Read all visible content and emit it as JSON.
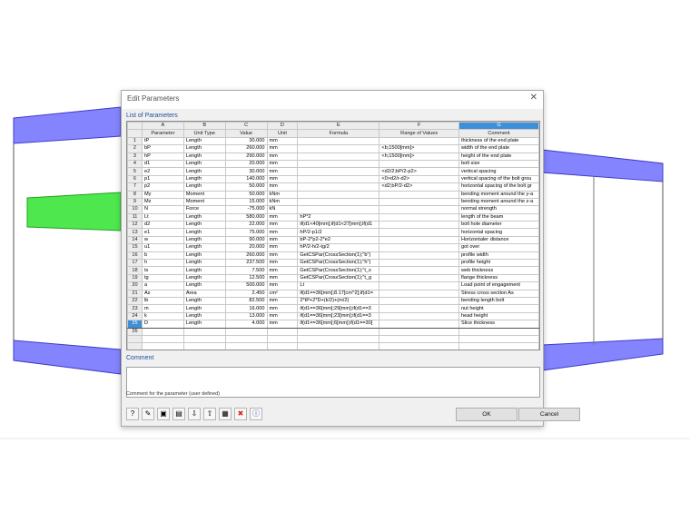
{
  "dialog": {
    "title": "Edit Parameters",
    "close_symbol": "✕",
    "list_label": "List of Parameters",
    "comment_label": "Comment",
    "comment_hint": "Comment for the parameter (user defined)",
    "ok_label": "OK",
    "cancel_label": "Cancel"
  },
  "table": {
    "letters": [
      "A",
      "B",
      "C",
      "D",
      "E",
      "F",
      "G"
    ],
    "headers": [
      "Parameter",
      "Unit Type",
      "Value",
      "Unit",
      "Formula",
      "Range of Values",
      "Comment"
    ],
    "rows": [
      {
        "num": "1",
        "cells": [
          "tP",
          "Length",
          "30.000",
          "mm",
          "",
          "",
          "thickness of the end plate"
        ]
      },
      {
        "num": "2",
        "cells": [
          "bP",
          "Length",
          "260.000",
          "mm",
          "",
          "<b;1500[mm]>",
          "width of the end plate"
        ]
      },
      {
        "num": "3",
        "cells": [
          "hP",
          "Length",
          "290.000",
          "mm",
          "",
          "<h;1500[mm]>",
          "height of the end plate"
        ]
      },
      {
        "num": "4",
        "cells": [
          "d1",
          "Length",
          "20.000",
          "mm",
          "",
          "",
          "bolt size"
        ]
      },
      {
        "num": "5",
        "cells": [
          "e2",
          "Length",
          "30.000",
          "mm",
          "",
          "<d2/2;bP/2-p2>",
          "vertical spacing"
        ]
      },
      {
        "num": "6",
        "cells": [
          "p1",
          "Length",
          "140.000",
          "mm",
          "",
          "<0>d2/r-d2>",
          "vertical spacing of the bolt grou"
        ]
      },
      {
        "num": "7",
        "cells": [
          "p2",
          "Length",
          "50.000",
          "mm",
          "",
          "<d2;bP/2-d2>",
          "horizontal spacing of the bolt gr"
        ]
      },
      {
        "num": "8",
        "cells": [
          "My",
          "Moment",
          "50.000",
          "kNm",
          "",
          "",
          "bending moment around the y-a"
        ]
      },
      {
        "num": "9",
        "cells": [
          "Mz",
          "Moment",
          "15.000",
          "kNm",
          "",
          "",
          "bending moment around the z-a"
        ]
      },
      {
        "num": "10",
        "cells": [
          "N",
          "Force",
          "-75.000",
          "kN",
          "",
          "",
          "normal strength"
        ]
      },
      {
        "num": "11",
        "cells": [
          "Lt",
          "Length",
          "580.000",
          "mm",
          "hP*2",
          "",
          "length of the beam"
        ]
      },
      {
        "num": "12",
        "cells": [
          "d2",
          "Length",
          "22.000",
          "mm",
          "if(d1<40[mm];if(d1<27[mm];if(d1",
          "",
          "bolt hole diameter"
        ]
      },
      {
        "num": "13",
        "cells": [
          "e1",
          "Length",
          "75.000",
          "mm",
          "hP/2-p1/2",
          "",
          "horizontal spacing"
        ]
      },
      {
        "num": "14",
        "cells": [
          "w",
          "Length",
          "90.000",
          "mm",
          "bP-2*p2-2*e2",
          "",
          "Horizontaler distance"
        ]
      },
      {
        "num": "15",
        "cells": [
          "u1",
          "Length",
          "20.000",
          "mm",
          "hP/2-h/2-tg/2",
          "",
          "got over"
        ]
      },
      {
        "num": "16",
        "cells": [
          "b",
          "Length",
          "260.000",
          "mm",
          "GetCSPar(CrossSection(1);\"b\")",
          "",
          "profile width"
        ]
      },
      {
        "num": "17",
        "cells": [
          "h",
          "Length",
          "237.500",
          "mm",
          "GetCSPar(CrossSection(1);\"h\")",
          "",
          "profile height"
        ]
      },
      {
        "num": "18",
        "cells": [
          "ts",
          "Length",
          "7.500",
          "mm",
          "GetCSPar(CrossSection(1);\"t_s",
          "",
          "web thickness"
        ]
      },
      {
        "num": "19",
        "cells": [
          "tg",
          "Length",
          "12.500",
          "mm",
          "GetCSPar(CrossSection(1);\"t_g",
          "",
          "flange thickness"
        ]
      },
      {
        "num": "20",
        "cells": [
          "a",
          "Length",
          "500.000",
          "mm",
          "Lt",
          "",
          "Load point of engagement"
        ]
      },
      {
        "num": "21",
        "cells": [
          "As",
          "Area",
          "2.450",
          "cm²",
          "if(d1==36[mm];8.17[cm^2];if(d1=",
          "",
          "Stress cross section As"
        ]
      },
      {
        "num": "22",
        "cells": [
          "lb",
          "Length",
          "82.500",
          "mm",
          "2*tP+2*D+(k/2)+(m/2)",
          "",
          "bending length bolt"
        ]
      },
      {
        "num": "23",
        "cells": [
          "m",
          "Length",
          "16.000",
          "mm",
          "if(d1==36[mm];29[mm];if(d1==3",
          "",
          "nut height"
        ]
      },
      {
        "num": "24",
        "cells": [
          "k",
          "Length",
          "13.000",
          "mm",
          "if(d1==36[mm];23[mm];if(d1==3",
          "",
          "head height"
        ]
      },
      {
        "num": "25",
        "cells": [
          "D",
          "Length",
          "4.000",
          "mm",
          "if(d1==36[mm];6[mm];if(d1==30[",
          "",
          "Slice thickness"
        ]
      },
      {
        "num": "26",
        "cells": [
          "",
          "",
          "",
          "",
          "",
          "",
          ""
        ]
      }
    ]
  },
  "toolbar": {
    "icons": [
      {
        "name": "help-icon",
        "glyph": "?"
      },
      {
        "name": "edit-icon",
        "glyph": "✎"
      },
      {
        "name": "save-icon",
        "glyph": "▣"
      },
      {
        "name": "open-folder-icon",
        "glyph": "▤"
      },
      {
        "name": "import-icon",
        "glyph": "⇩"
      },
      {
        "name": "export-icon",
        "glyph": "⇧"
      },
      {
        "name": "table-icon",
        "glyph": "▦"
      },
      {
        "name": "delete-icon",
        "glyph": "✖"
      },
      {
        "name": "info-icon",
        "glyph": "ⓘ"
      }
    ]
  },
  "colors": {
    "beam_fill": "#8484ff",
    "beam_edge": "#3c3cc8",
    "green_fill": "#4ee84e",
    "selection": "#3d8fd9",
    "label_blue": "#1f4e9c"
  }
}
